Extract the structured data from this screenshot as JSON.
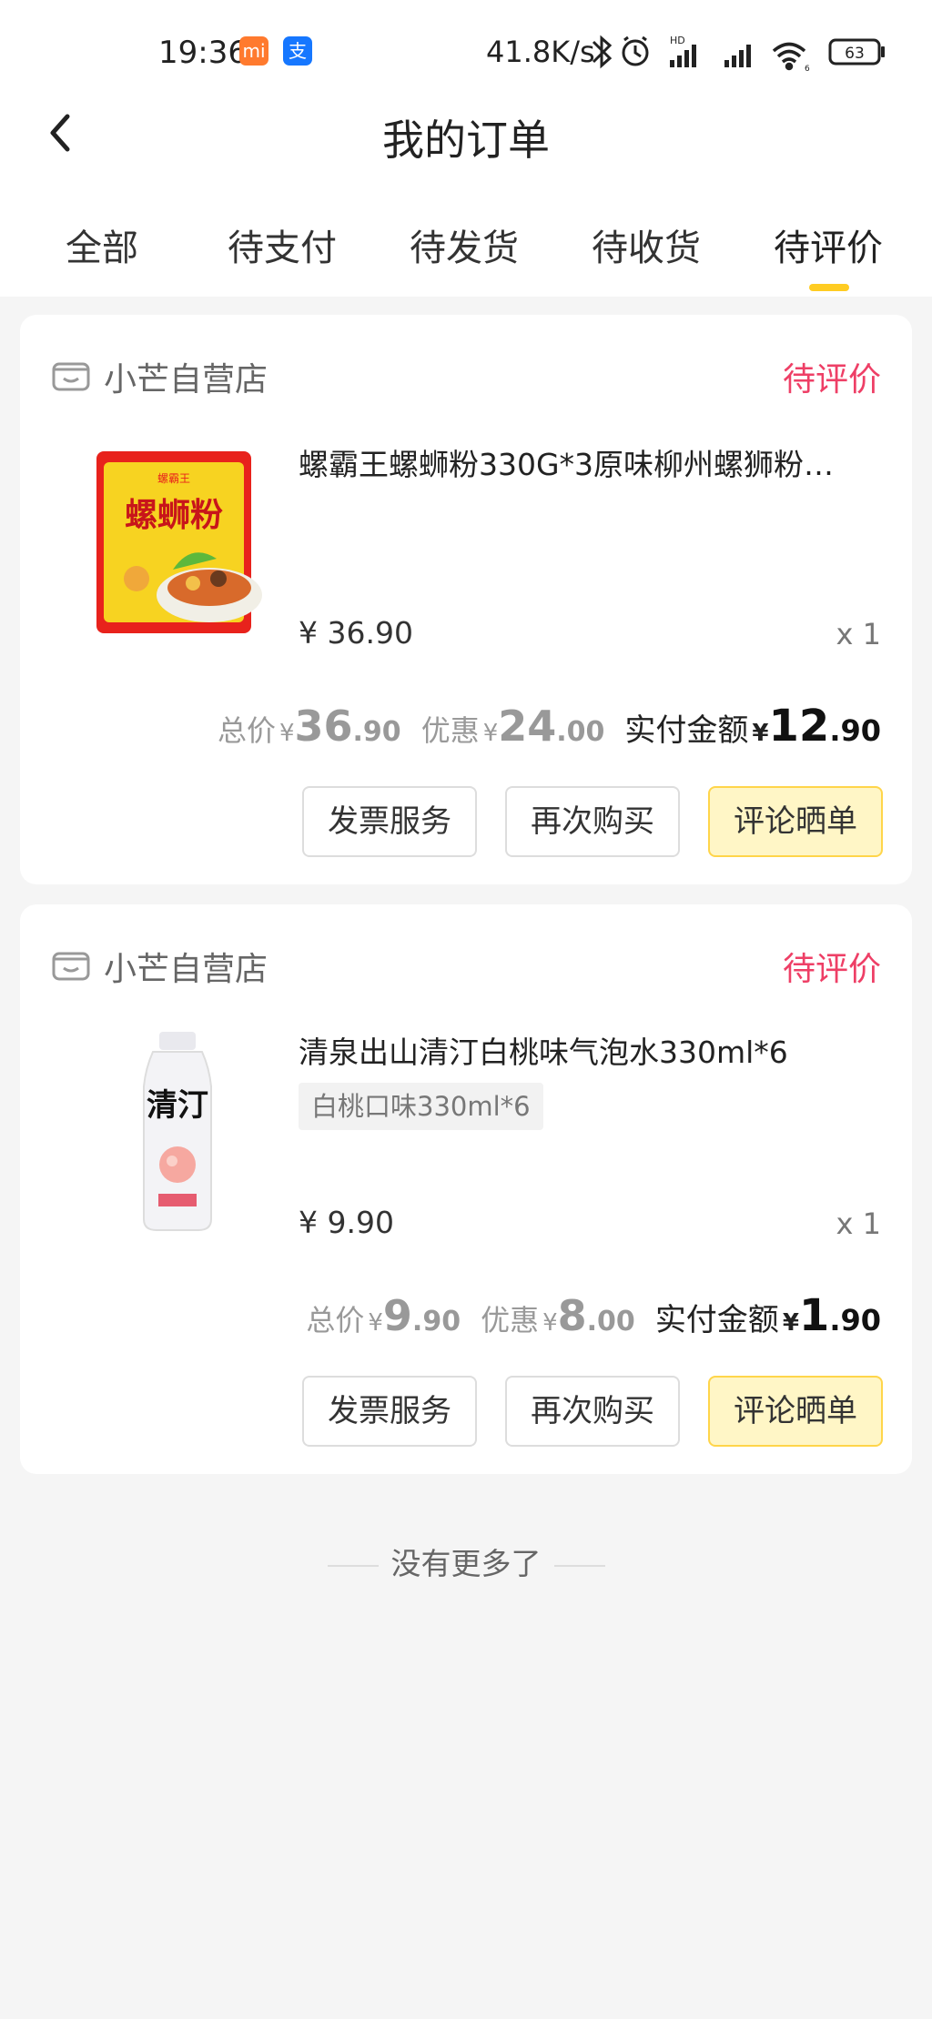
{
  "status_bar": {
    "time": "19:36",
    "app_icons": [
      "mi-app-icon",
      "alipay-icon"
    ],
    "mi_glyph": "mi",
    "alipay_glyph": "支",
    "net_speed": "41.8K/s",
    "battery": "63",
    "signal_hd": "HD",
    "wifi_sub": "6"
  },
  "header": {
    "title": "我的订单"
  },
  "tabs": [
    {
      "label": "全部"
    },
    {
      "label": "待支付"
    },
    {
      "label": "待发货"
    },
    {
      "label": "待收货"
    },
    {
      "label": "待评价",
      "active": true
    }
  ],
  "orders": [
    {
      "store": "小芒自营店",
      "status": "待评价",
      "product_name": "螺霸王螺蛳粉330G*3原味柳州螺狮粉…",
      "variant": "",
      "unit_price": "¥ 36.90",
      "qty": "x 1",
      "total_label": "总价",
      "total_int": "36",
      "total_dec": ".90",
      "discount_label": "优惠",
      "discount_int": "24",
      "discount_dec": ".00",
      "paid_label": "实付金额",
      "paid_int": "12",
      "paid_dec": ".90",
      "currency": "¥",
      "buttons": {
        "invoice": "发票服务",
        "rebuy": "再次购买",
        "review": "评论晒单"
      },
      "thumb_text": "螺蛳粉",
      "thumb_brand": "螺霸王"
    },
    {
      "store": "小芒自营店",
      "status": "待评价",
      "product_name": "清泉出山清汀白桃味气泡水330ml*6",
      "variant": "白桃口味330ml*6",
      "unit_price": "¥ 9.90",
      "qty": "x 1",
      "total_label": "总价",
      "total_int": "9",
      "total_dec": ".90",
      "discount_label": "优惠",
      "discount_int": "8",
      "discount_dec": ".00",
      "paid_label": "实付金额",
      "paid_int": "1",
      "paid_dec": ".90",
      "currency": "¥",
      "buttons": {
        "invoice": "发票服务",
        "rebuy": "再次购买",
        "review": "评论晒单"
      },
      "thumb_text": "清汀"
    }
  ],
  "footer": {
    "no_more": "没有更多了"
  },
  "colors": {
    "accent": "#ffcc22",
    "status": "#ee3f66",
    "highlight_btn": "#fff6c6"
  }
}
